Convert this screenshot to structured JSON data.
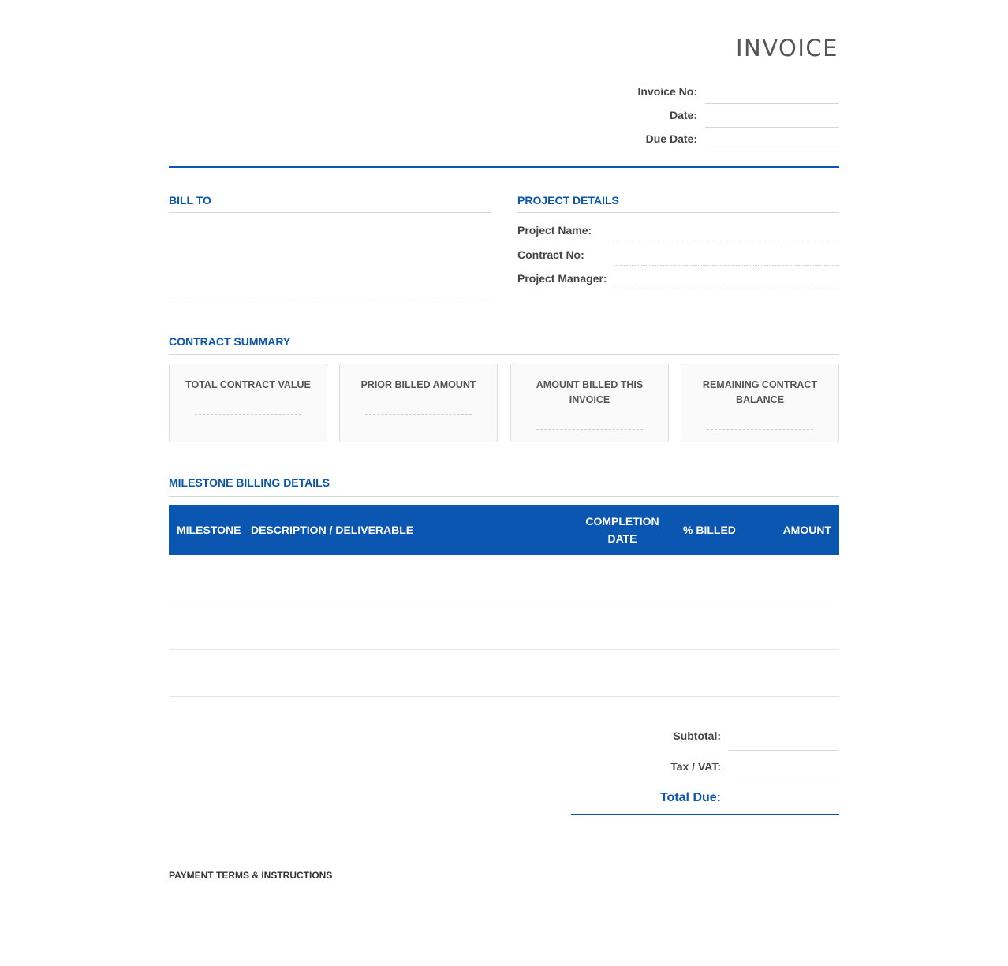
{
  "header": {
    "title": "INVOICE",
    "invoice_no_label": "Invoice No:",
    "date_label": "Date:",
    "due_date_label": "Due Date:"
  },
  "bill_to": {
    "title": "BILL TO"
  },
  "project_details": {
    "title": "PROJECT DETAILS",
    "project_name_label": "Project Name:",
    "contract_no_label": "Contract No:",
    "project_manager_label": "Project Manager:"
  },
  "contract_summary": {
    "title": "CONTRACT SUMMARY",
    "cards": [
      {
        "label": "TOTAL CONTRACT VALUE"
      },
      {
        "label": "PRIOR BILLED AMOUNT"
      },
      {
        "label": "AMOUNT BILLED THIS INVOICE"
      },
      {
        "label": "REMAINING CONTRACT BALANCE"
      }
    ]
  },
  "milestones": {
    "title": "MILESTONE BILLING DETAILS",
    "columns": {
      "milestone": "MILESTONE",
      "description": "DESCRIPTION / DELIVERABLE",
      "completion_line1": "COMPLETION",
      "completion_line2": "DATE",
      "percent_billed": "% BILLED",
      "amount": "AMOUNT"
    }
  },
  "totals": {
    "subtotal_label": "Subtotal:",
    "tax_label": "Tax / VAT:",
    "total_due_label": "Total Due:"
  },
  "footer": {
    "payment_terms_title": "PAYMENT TERMS & INSTRUCTIONS"
  },
  "colors": {
    "accent": "#0a56b0",
    "text": "#444444",
    "rule": "#d6d6d6"
  }
}
